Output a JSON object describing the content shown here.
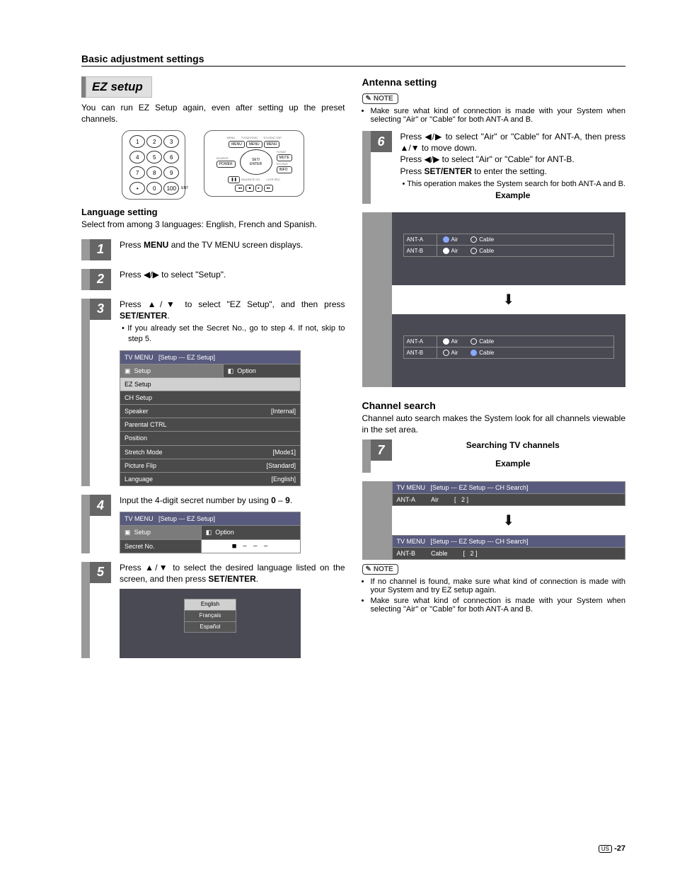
{
  "section_title": "Basic adjustment settings",
  "ez_setup": {
    "heading": "EZ setup",
    "intro": "You can run EZ Setup again, even after setting up the preset channels.",
    "keypad": [
      "1",
      "2",
      "3",
      "4",
      "5",
      "6",
      "7",
      "8",
      "9",
      "•",
      "0",
      "100"
    ],
    "keypad_ent": "ENT",
    "dpad": {
      "top_labels": [
        "MENU",
        "TV/SAT/DVD",
        "DTV/DIG.TOP"
      ],
      "top_btns": [
        "MENU",
        "MENU",
        "MENU"
      ],
      "left_label": "SOURCE",
      "left_btn": "POWER",
      "right_label_top": "TV/SAT",
      "right_btn_top": "MUTE",
      "right_label_bot": "DTV/SAT",
      "right_btn_bot": "INFO",
      "center": "SET/\nENTER",
      "bottom_label": "FAVORITE CH.",
      "bottom_label_right": "• VCR REC",
      "transport": [
        "◂◂",
        "■",
        "▸",
        "▸▸"
      ],
      "pause": "❚❚"
    },
    "lang_h": "Language setting",
    "lang_p": "Select from among 3 languages: English, French and Spanish."
  },
  "steps": {
    "s1": "Press ",
    "s1_b": "MENU",
    "s1_2": " and the TV MENU screen displays.",
    "s2": "Press ◀/▶ to select \"Setup\".",
    "s3": "Press ▲/▼ to select \"EZ Setup\", and then press ",
    "s3_b": "SET/ENTER",
    "s3_bul": "• If you already set the Secret No., go to step 4. If not, skip to step 5.",
    "s4": "Input the 4-digit secret number by using ",
    "s4_b": "0",
    "s4_mid": " – ",
    "s4_b2": "9",
    "s4_end": ".",
    "s5": "Press ▲/▼ to select the desired language listed on the screen, and then press ",
    "s5_b": "SET/ENTER",
    "s5_end": ".",
    "s6": "Press ◀/▶ to select \"Air\" or \"Cable\" for ANT-A, then press ▲/▼ to move down.",
    "s6_l2": "Press ◀/▶ to select \"Air\" or \"Cable\" for ANT-B.",
    "s6_l3a": "Press ",
    "s6_l3b": "SET/ENTER",
    "s6_l3c": " to enter the setting.",
    "s6_bul": "• This operation makes the System search for both ANT-A and B."
  },
  "menu3": {
    "title": "TV MENU",
    "crumb": "[Setup --- EZ Setup]",
    "tab1": "Setup",
    "tab2": "Option",
    "rows": [
      [
        "EZ Setup",
        ""
      ],
      [
        "CH Setup",
        ""
      ],
      [
        "Speaker",
        "[Internal]"
      ],
      [
        "Parental CTRL",
        ""
      ],
      [
        "Position",
        ""
      ],
      [
        "Stretch Mode",
        "[Mode1]"
      ],
      [
        "Picture Flip",
        "[Standard]"
      ],
      [
        "Language",
        "[English]"
      ]
    ]
  },
  "menu4": {
    "title": "TV MENU",
    "crumb": "[Setup --- EZ Setup]",
    "tab1": "Setup",
    "tab2": "Option",
    "row_l": "Secret No.",
    "row_r": "■ – – –"
  },
  "lang_panel": [
    "English",
    "Français",
    "Español"
  ],
  "antenna": {
    "heading": "Antenna setting",
    "note_label": "NOTE",
    "note1": "Make sure what kind of connection is made with your System when selecting \"Air\" or \"Cable\" for both ANT-A and B.",
    "example": "Example",
    "rows_top": [
      {
        "l": "ANT-A",
        "air_on": true,
        "cable_on": false,
        "air_blue": true
      },
      {
        "l": "ANT-B",
        "air_on": true,
        "cable_on": false
      }
    ],
    "rows_bot": [
      {
        "l": "ANT-A",
        "air_on": true,
        "cable_on": false
      },
      {
        "l": "ANT-B",
        "air_on": false,
        "cable_on": true,
        "cable_blue": true
      }
    ],
    "air": "Air",
    "cable": "Cable"
  },
  "channel": {
    "heading": "Channel search",
    "intro": "Channel auto search makes the System look for all channels viewable in the set area.",
    "step7_h": "Searching TV channels",
    "example": "Example",
    "bar1": {
      "title": "TV MENU",
      "crumb": "[Setup --- EZ Setup --- CH Search]",
      "l": "ANT-A",
      "m": "Air",
      "r": "[   2 ]"
    },
    "bar2": {
      "title": "TV MENU",
      "crumb": "[Setup --- EZ Setup --- CH Search]",
      "l": "ANT-B",
      "m": "Cable",
      "r": "[   2 ]"
    },
    "note2a": "If no channel is found, make sure what kind of connection is made with your System and try EZ setup again.",
    "note2b": "Make sure what kind of connection is made with your System when selecting \"Air\" or \"Cable\" for both ANT-A and B."
  },
  "page_num": "-27",
  "page_region": "US"
}
